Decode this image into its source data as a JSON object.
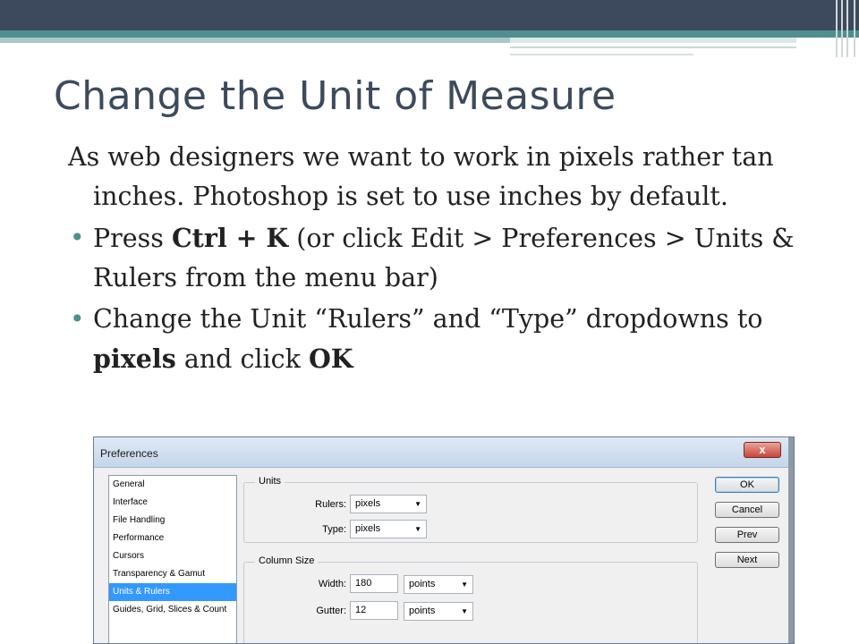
{
  "slide": {
    "title": "Change the Unit of Measure",
    "intro": "As web designers we want to work in pixels rather tan inches. Photoshop is set to use inches by default.",
    "bullet1": {
      "pre": "Press ",
      "keys": "Ctrl + K",
      "post": "  (or click Edit > Preferences > Units & Rulers from the menu bar)"
    },
    "bullet2": {
      "pre": "Change  the Unit “Rulers” and “Type” dropdowns to ",
      "bold1": "pixels",
      "mid": " and click ",
      "bold2": "OK"
    },
    "accent_color": "#4f8f8f",
    "title_color": "#3d4a5e"
  },
  "dialog": {
    "title": "Preferences",
    "close_label": "x",
    "nav_items": [
      "General",
      "Interface",
      "File Handling",
      "Performance",
      "Cursors",
      "Transparency & Gamut",
      "Units & Rulers",
      "Guides, Grid, Slices & Count"
    ],
    "selected_nav": "Units & Rulers",
    "units": {
      "label": "Units",
      "rulers_label": "Rulers:",
      "rulers_value": "pixels",
      "type_label": "Type:",
      "type_value": "pixels"
    },
    "column_size": {
      "label": "Column Size",
      "width_label": "Width:",
      "width_value": "180",
      "width_unit": "points",
      "gutter_label": "Gutter:",
      "gutter_value": "12",
      "gutter_unit": "points"
    },
    "buttons": {
      "ok": "OK",
      "cancel": "Cancel",
      "prev": "Prev",
      "next": "Next"
    }
  }
}
